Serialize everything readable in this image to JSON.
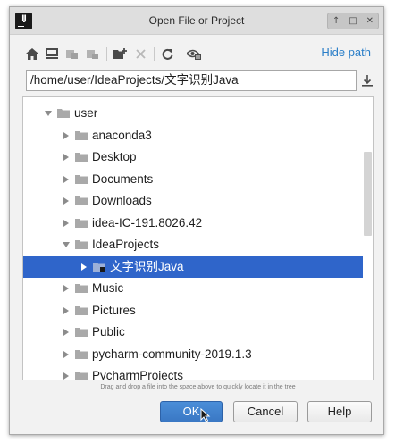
{
  "window": {
    "title": "Open File or Project",
    "controls": [
      "↑",
      "□",
      "✕"
    ]
  },
  "toolbar": {
    "icons": [
      "home-icon",
      "desktop-icon",
      "project-icon",
      "module-icon",
      "new-folder-icon",
      "delete-icon",
      "refresh-icon",
      "show-hidden-icon"
    ],
    "hide_path_label": "Hide path"
  },
  "path": {
    "value": "/home/user/IdeaProjects/文字识别Java"
  },
  "tree": {
    "items": [
      {
        "label": "user",
        "expanded": true,
        "level": 0
      },
      {
        "label": "anaconda3",
        "expanded": false,
        "level": 1
      },
      {
        "label": "Desktop",
        "expanded": false,
        "level": 1
      },
      {
        "label": "Documents",
        "expanded": false,
        "level": 1
      },
      {
        "label": "Downloads",
        "expanded": false,
        "level": 1
      },
      {
        "label": "idea-IC-191.8026.42",
        "expanded": false,
        "level": 1
      },
      {
        "label": "IdeaProjects",
        "expanded": true,
        "level": 1
      },
      {
        "label": "文字识别Java",
        "expanded": false,
        "level": 2,
        "selected": true
      },
      {
        "label": "Music",
        "expanded": false,
        "level": 1
      },
      {
        "label": "Pictures",
        "expanded": false,
        "level": 1
      },
      {
        "label": "Public",
        "expanded": false,
        "level": 1
      },
      {
        "label": "pycharm-community-2019.1.3",
        "expanded": false,
        "level": 1
      },
      {
        "label": "PycharmProjects",
        "expanded": false,
        "level": 1
      }
    ]
  },
  "hint": "Drag and drop a file into the space above to quickly locate it in the tree",
  "buttons": {
    "ok": "OK",
    "cancel": "Cancel",
    "help": "Help"
  },
  "colors": {
    "selection": "#2f65ca",
    "link": "#2a7ec8",
    "ok_button": "#3f82cf"
  }
}
